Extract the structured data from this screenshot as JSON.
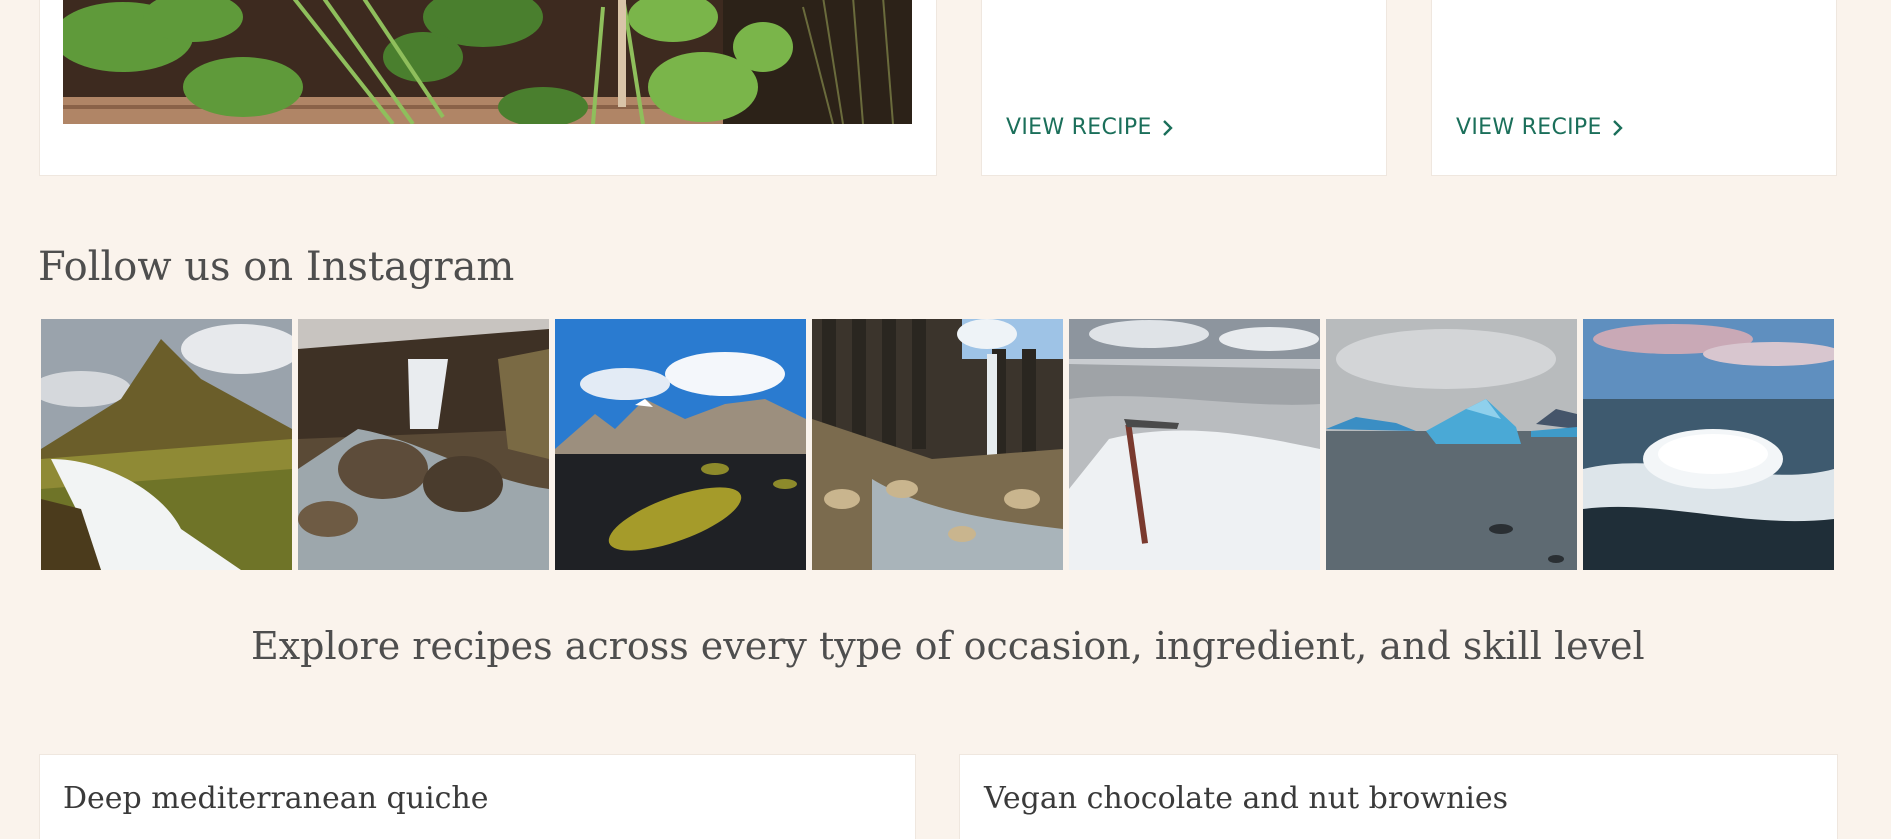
{
  "top_cards": [
    {
      "link_label": "VIEW RECIPE",
      "link_icon": "chevron-right-icon"
    },
    {
      "link_label": "VIEW RECIPE",
      "link_icon": "chevron-right-icon"
    }
  ],
  "instagram": {
    "heading": "Follow us on Instagram",
    "photos": [
      {
        "subject": "mountain-waterfall-photo"
      },
      {
        "subject": "rocky-waterfall-photo"
      },
      {
        "subject": "mountain-beach-photo"
      },
      {
        "subject": "basalt-waterfall-photo"
      },
      {
        "subject": "glacier-ice-axe-photo"
      },
      {
        "subject": "iceberg-lagoon-photo"
      },
      {
        "subject": "ice-on-beach-photo"
      }
    ]
  },
  "explore": {
    "heading": "Explore recipes across every type of occasion, ingredient, and skill level"
  },
  "recipes": [
    {
      "title": "Deep mediterranean quiche"
    },
    {
      "title": "Vegan chocolate and nut brownies"
    }
  ],
  "colors": {
    "page_background": "#faf3ec",
    "card_background": "#ffffff",
    "link_accent": "#1b6f5a",
    "heading_text": "#4e4e4e"
  }
}
